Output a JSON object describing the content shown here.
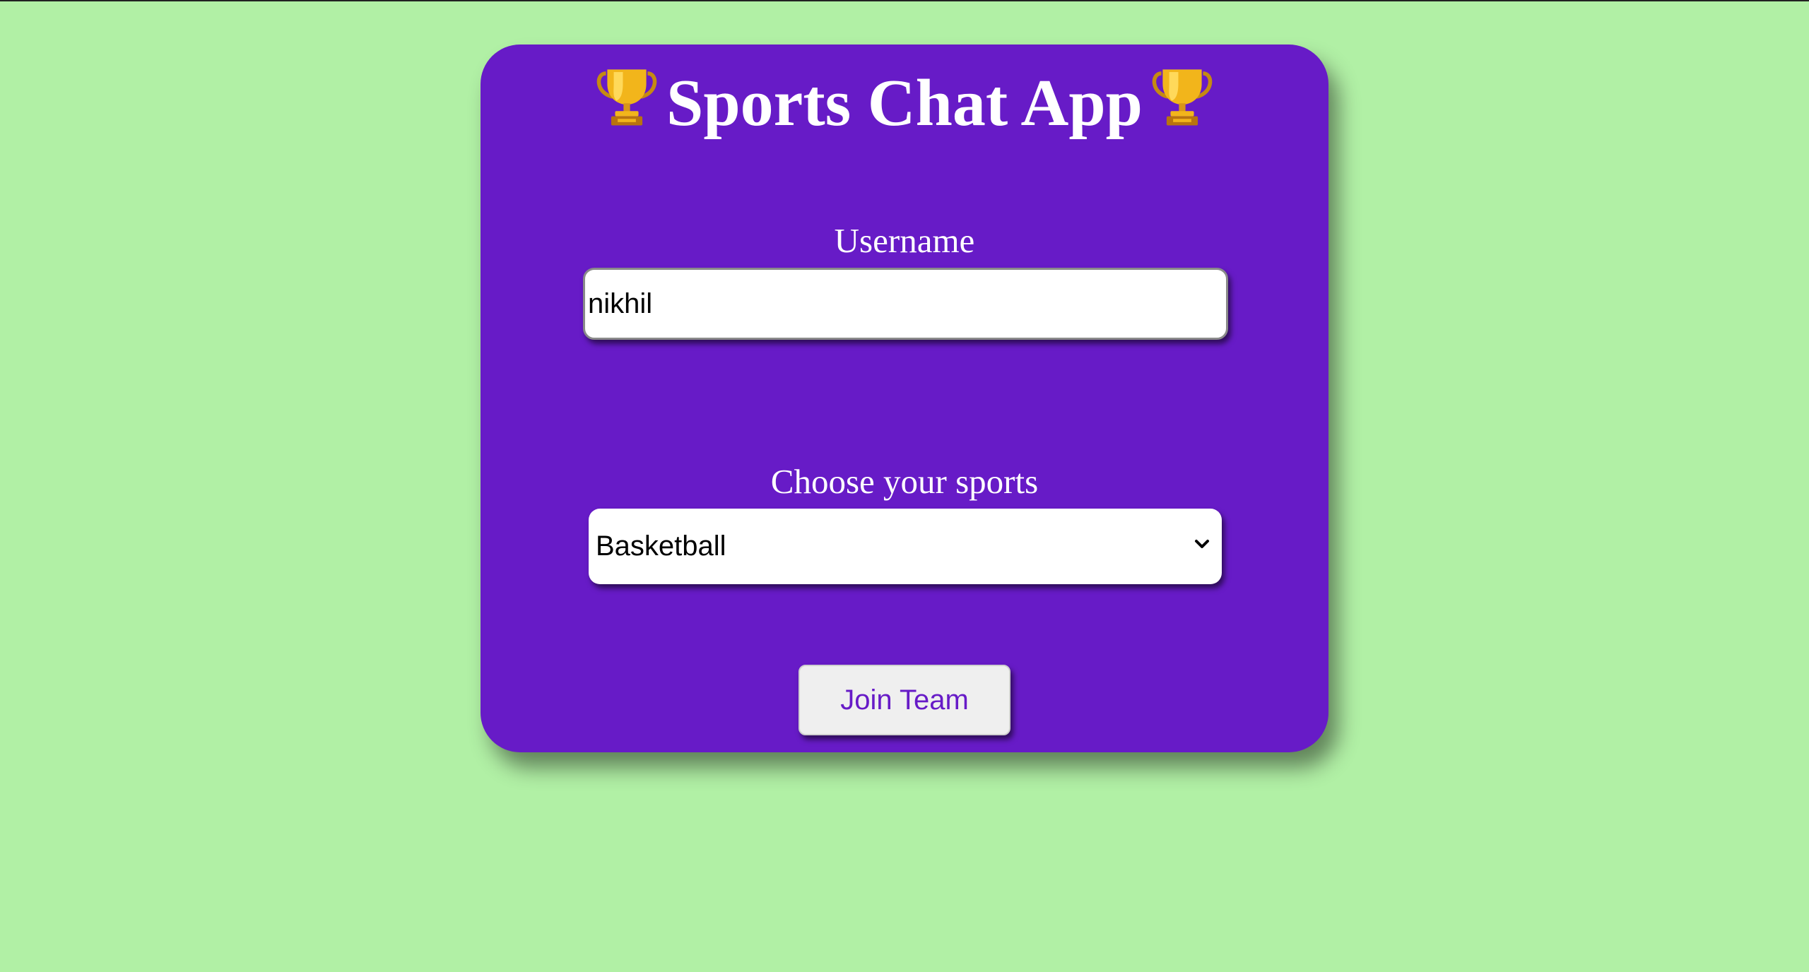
{
  "app": {
    "title": "Sports Chat App",
    "title_icon": "trophy-icon"
  },
  "form": {
    "username_label": "Username",
    "username_value": "nikhil",
    "sports_label": "Choose your sports",
    "sports_selected": "Basketball",
    "join_button_label": "Join Team"
  },
  "colors": {
    "background": "#b1f0a5",
    "card": "#671bc7",
    "text": "#ffffff",
    "button_text": "#671bc7"
  }
}
